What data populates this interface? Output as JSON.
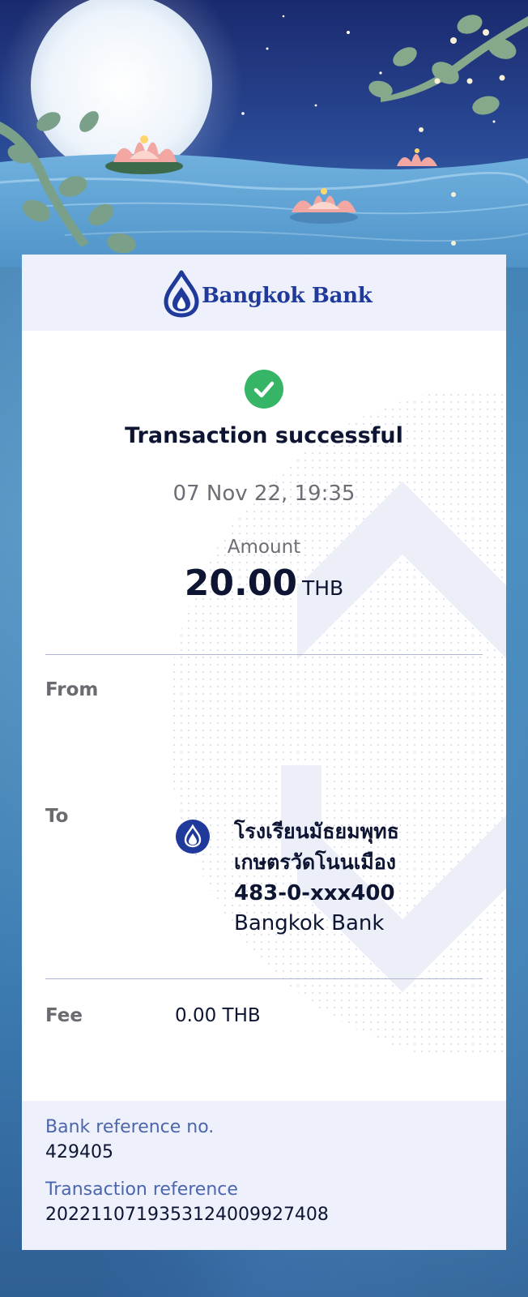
{
  "colors": {
    "brand": "#1f3a9a",
    "success": "#35b565",
    "heading": "#0d1533",
    "muted": "#6d6d75",
    "ref_label": "#4c66ad"
  },
  "header": {
    "logo_icon": "bangkok-bank-lotus-icon",
    "bank_name": "Bangkok Bank"
  },
  "status": {
    "icon": "check-circle-icon",
    "title": "Transaction successful",
    "datetime": "07 Nov 22, 19:35"
  },
  "amount": {
    "label": "Amount",
    "value": "20.00",
    "currency": "THB"
  },
  "details": {
    "from_label": "From",
    "to_label": "To",
    "to_icon": "bangkok-bank-badge-icon",
    "to_name_line1": "โรงเรียนมัธยมพุทธ",
    "to_name_line2": "เกษตรวัดโนนเมือง",
    "to_account": "483-0-xxx400",
    "to_bank": "Bangkok Bank",
    "fee_label": "Fee",
    "fee_value": "0.00 THB"
  },
  "references": {
    "bank_ref_label": "Bank reference no.",
    "bank_ref_value": "429405",
    "txn_ref_label": "Transaction reference",
    "txn_ref_value": "2022110719353124009927408"
  }
}
